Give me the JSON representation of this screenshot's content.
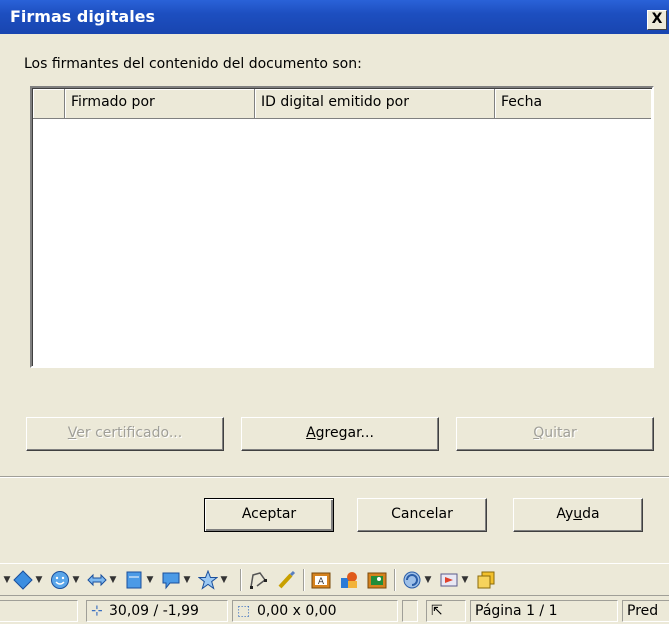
{
  "window": {
    "title": "Firmas digitales",
    "close_glyph": "X"
  },
  "dialog": {
    "intro": "Los firmantes del contenido del documento son:",
    "columns": [
      "",
      "Firmado por",
      "ID digital emitido por",
      "Fecha"
    ],
    "rows": []
  },
  "actions": {
    "view_cert": {
      "label": "Ver certificado...",
      "mnemonic": "V",
      "rest": "er certificado...",
      "enabled": false
    },
    "add": {
      "label": "Agregar...",
      "mnemonic": "A",
      "rest": "gregar...",
      "enabled": true
    },
    "remove": {
      "label": "Quitar",
      "mnemonic": "Q",
      "rest": "uitar",
      "enabled": false
    }
  },
  "footer": {
    "ok": "Aceptar",
    "cancel": "Cancelar",
    "help_pre": "Ay",
    "help_mnemonic": "u",
    "help_post": "da"
  },
  "toolbar": {
    "icons": [
      "diamond-shape-icon",
      "smiley-shape-icon",
      "double-arrow-icon",
      "flowchart-icon",
      "callout-icon",
      "star-icon",
      "points-icon",
      "glue-icon",
      "fontwork-icon",
      "image-icon",
      "insert-frame-icon",
      "extrusion-icon",
      "animation-icon",
      "gallery-icon"
    ]
  },
  "status": {
    "position": "30,09 / -1,99",
    "size": "0,00 x 0,00",
    "page": "Página 1 / 1",
    "style": "Pred"
  },
  "colors": {
    "titlebar": "#1d4fc0",
    "face": "#ece9d8",
    "disabled_text": "#a09f98"
  }
}
